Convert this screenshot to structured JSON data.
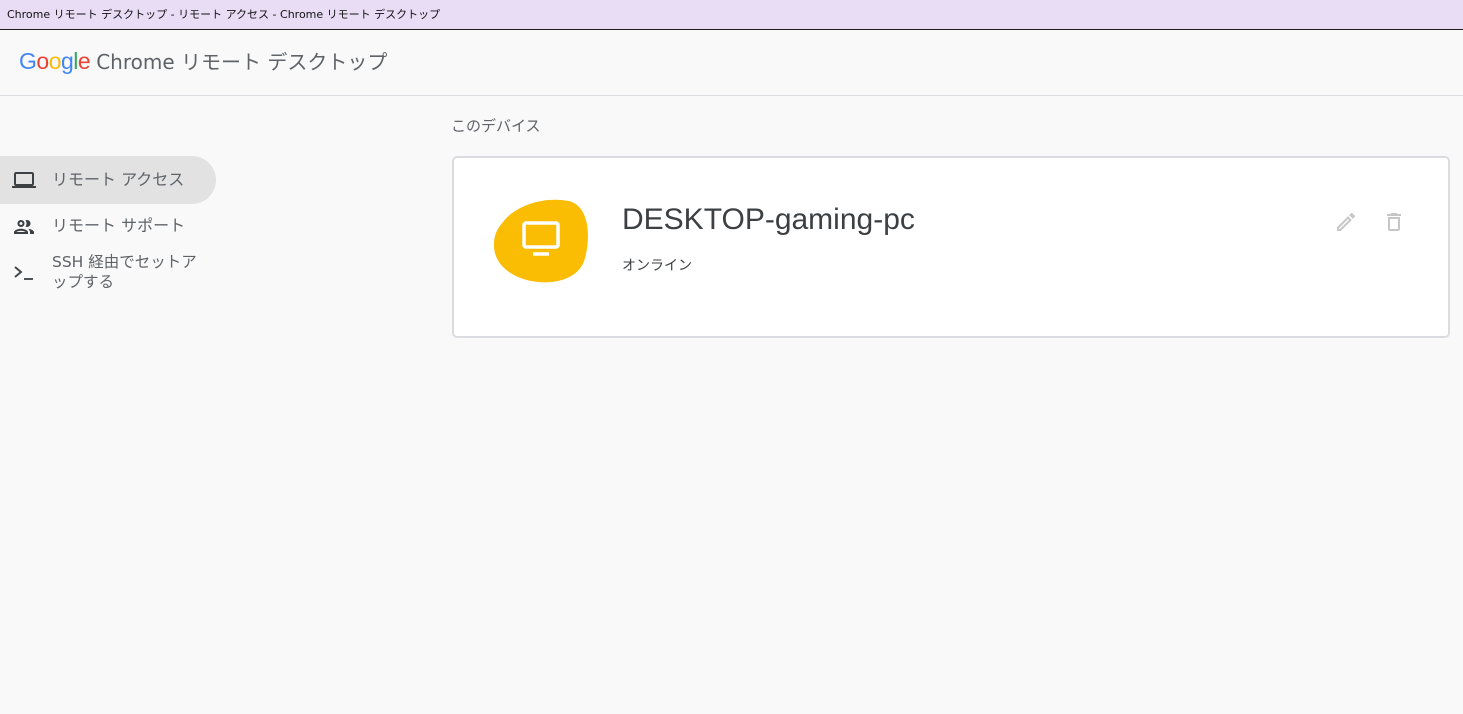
{
  "window": {
    "title": "Chrome リモート デスクトップ - リモート アクセス - Chrome リモート デスクトップ"
  },
  "header": {
    "logo_letters": [
      "G",
      "o",
      "o",
      "g",
      "l",
      "e"
    ],
    "logo_colors": [
      "#4285f4",
      "#ea4335",
      "#fbbc05",
      "#4285f4",
      "#34a853",
      "#ea4335"
    ],
    "product_name": "Chrome リモート デスクトップ"
  },
  "sidebar": {
    "items": [
      {
        "label": "リモート アクセス",
        "icon": "laptop-icon",
        "active": true
      },
      {
        "label": "リモート サポート",
        "icon": "people-icon",
        "active": false
      },
      {
        "label": "SSH 経由でセットアップする",
        "icon": "terminal-icon",
        "active": false
      }
    ]
  },
  "main": {
    "section_title": "このデバイス",
    "device": {
      "name": "DESKTOP-gaming-pc",
      "status": "オンライン",
      "icon": "monitor-icon",
      "accent_color": "#fbbc04"
    },
    "actions": {
      "edit_icon": "pencil-icon",
      "delete_icon": "trash-icon"
    }
  }
}
